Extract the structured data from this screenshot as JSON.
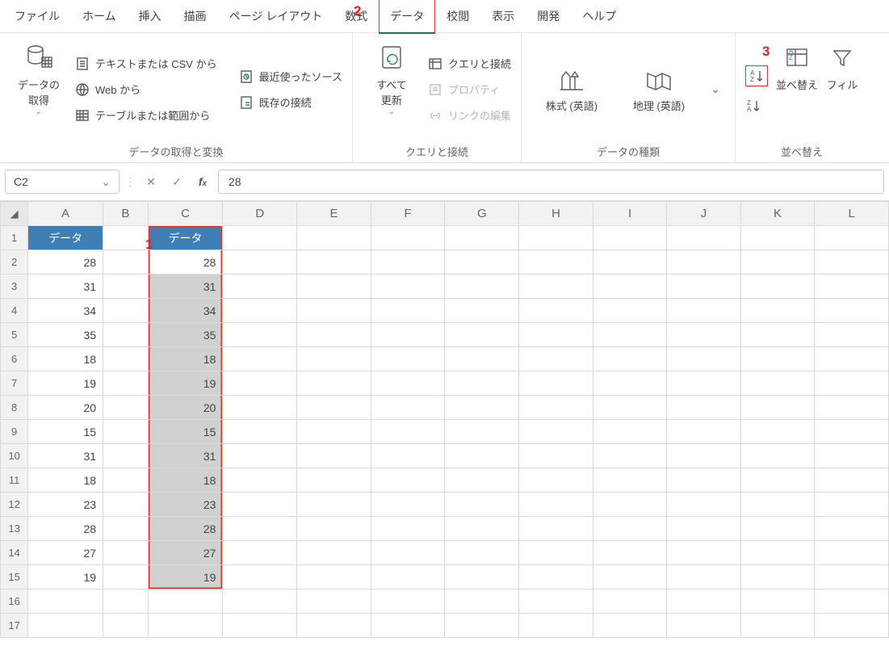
{
  "menu": [
    "ファイル",
    "ホーム",
    "挿入",
    "描画",
    "ページ レイアウト",
    "数式",
    "データ",
    "校閲",
    "表示",
    "開発",
    "ヘルプ"
  ],
  "menu_active": 6,
  "ribbon": {
    "g1": {
      "label": "データの取得と変換",
      "big": "データの\n取得",
      "items": [
        "テキストまたは CSV から",
        "Web から",
        "テーブルまたは範囲から"
      ],
      "items2": [
        "最近使ったソース",
        "既存の接続"
      ]
    },
    "g2": {
      "label": "クエリと接続",
      "big": "すべて\n更新",
      "items": [
        {
          "t": "クエリと接続",
          "d": false
        },
        {
          "t": "プロパティ",
          "d": true
        },
        {
          "t": "リンクの編集",
          "d": true
        }
      ]
    },
    "g3": {
      "label": "データの種類",
      "a": "株式 (英語)",
      "b": "地理 (英語)"
    },
    "g4": {
      "label": "並べ替え",
      "sort": "並べ替え",
      "fil": "フィル"
    }
  },
  "annotations": {
    "a1": "1",
    "a2": "2",
    "a3": "3"
  },
  "namebox": "C2",
  "formula": "28",
  "cols": [
    "A",
    "B",
    "C",
    "D",
    "E",
    "F",
    "G",
    "H",
    "I",
    "J",
    "K",
    "L"
  ],
  "headerLabel": "データ",
  "rows": [
    {
      "r": 1,
      "a": "データ",
      "c": "データ",
      "hdr": true
    },
    {
      "r": 2,
      "a": "28",
      "c": "28"
    },
    {
      "r": 3,
      "a": "31",
      "c": "31"
    },
    {
      "r": 4,
      "a": "34",
      "c": "34"
    },
    {
      "r": 5,
      "a": "35",
      "c": "35"
    },
    {
      "r": 6,
      "a": "18",
      "c": "18"
    },
    {
      "r": 7,
      "a": "19",
      "c": "19"
    },
    {
      "r": 8,
      "a": "20",
      "c": "20"
    },
    {
      "r": 9,
      "a": "15",
      "c": "15"
    },
    {
      "r": 10,
      "a": "31",
      "c": "31"
    },
    {
      "r": 11,
      "a": "18",
      "c": "18"
    },
    {
      "r": 12,
      "a": "23",
      "c": "23"
    },
    {
      "r": 13,
      "a": "28",
      "c": "28"
    },
    {
      "r": 14,
      "a": "27",
      "c": "27"
    },
    {
      "r": 15,
      "a": "19",
      "c": "19"
    },
    {
      "r": 16
    },
    {
      "r": 17
    }
  ],
  "selection": {
    "col": "C",
    "from": 2,
    "to": 15,
    "active": 2
  }
}
